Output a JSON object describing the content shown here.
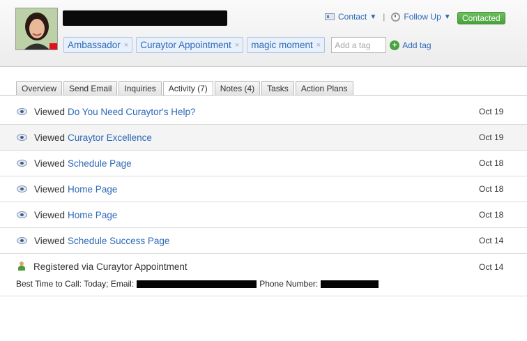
{
  "contact": {
    "status": "Contacted",
    "actions": {
      "contact_label": "Contact",
      "follow_up_label": "Follow Up",
      "separator": "|"
    }
  },
  "tags": {
    "items": [
      {
        "label": "Ambassador"
      },
      {
        "label": "Curaytor Appointment"
      },
      {
        "label": "magic moment"
      }
    ],
    "remove_glyph": "×",
    "input_placeholder": "Add a tag",
    "add_label": "Add tag",
    "add_glyph": "+"
  },
  "tabs": [
    {
      "label": "Overview",
      "active": false
    },
    {
      "label": "Send Email",
      "active": false
    },
    {
      "label": "Inquiries",
      "active": false
    },
    {
      "label": "Activity (7)",
      "active": true
    },
    {
      "label": "Notes (4)",
      "active": false
    },
    {
      "label": "Tasks",
      "active": false
    },
    {
      "label": "Action Plans",
      "active": false
    }
  ],
  "activity": {
    "views": [
      {
        "verb": "Viewed",
        "page": "Do You Need Curaytor's Help?",
        "date": "Oct 19"
      },
      {
        "verb": "Viewed",
        "page": "Curaytor Excellence",
        "date": "Oct 19"
      },
      {
        "verb": "Viewed",
        "page": "Schedule Page",
        "date": "Oct 18"
      },
      {
        "verb": "Viewed",
        "page": "Home Page",
        "date": "Oct 18"
      },
      {
        "verb": "Viewed",
        "page": "Home Page",
        "date": "Oct 18"
      },
      {
        "verb": "Viewed",
        "page": "Schedule Success Page",
        "date": "Oct 14"
      }
    ],
    "registration": {
      "text": "Registered via Curaytor Appointment",
      "date": "Oct 14",
      "best_time_label": "Best Time to Call: Today; Email:",
      "phone_label": "Phone Number:"
    }
  },
  "colors": {
    "link": "#2c68b8",
    "status_green": "#48a23b",
    "redaction": "#050505"
  }
}
